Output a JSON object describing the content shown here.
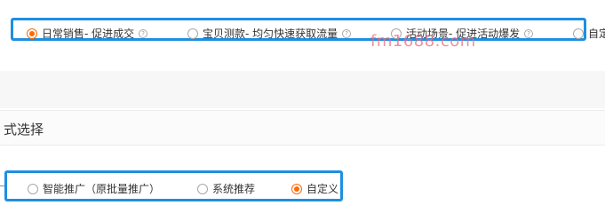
{
  "goal": {
    "options": [
      {
        "label": "日常销售- 促进成交",
        "selected": true,
        "help": "?"
      },
      {
        "label": "宝贝测款- 均匀快速获取流量",
        "selected": false,
        "help": "?"
      },
      {
        "label": "活动场景- 促进活动爆发",
        "selected": false,
        "help": "?"
      },
      {
        "label": "自定",
        "selected": false
      }
    ]
  },
  "watermark": "fm1688.com",
  "section": {
    "title": "式选择"
  },
  "mode": {
    "options": [
      {
        "label": "智能推广（原批量推广）",
        "selected": false
      },
      {
        "label": "系统推荐",
        "selected": false
      },
      {
        "label": "自定义",
        "selected": true
      }
    ]
  },
  "colors": {
    "accent": "#ff6a00",
    "highlight": "#1e8fe1"
  }
}
